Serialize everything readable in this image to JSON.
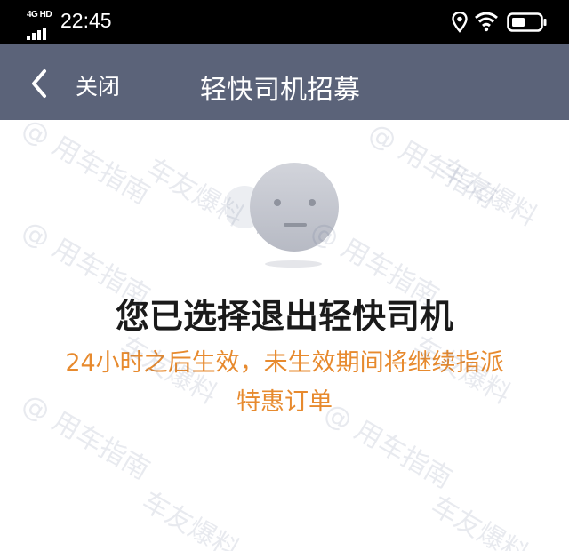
{
  "status_bar": {
    "network": "4G HD",
    "time": "22:45"
  },
  "header": {
    "back_icon": "chevron-left-icon",
    "close_label": "关闭",
    "title": "轻快司机招募"
  },
  "content": {
    "illustration_icon": "neutral-face-chat-bubble-icon",
    "title": "您已选择退出轻快司机",
    "subtitle_line1": "24小时之后生效，未生效期间将继续指派",
    "subtitle_line2": "特惠订单"
  },
  "watermark": {
    "text_a": "@ 用车指南",
    "text_b": "车友爆料"
  },
  "colors": {
    "header_bg": "#5b6379",
    "subtitle": "#e78a2e",
    "title": "#1a1a1a"
  }
}
